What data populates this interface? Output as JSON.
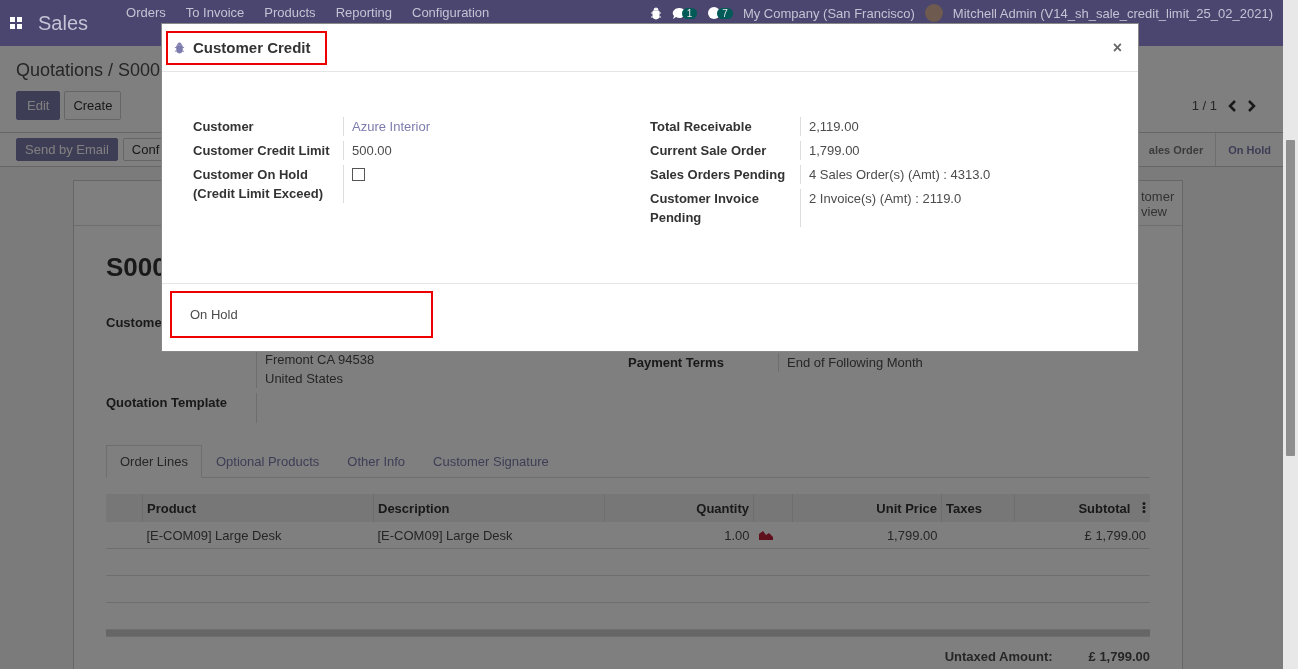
{
  "navbar": {
    "app_title": "Sales",
    "menu": [
      "Orders",
      "To Invoice",
      "Products",
      "Reporting",
      "Configuration"
    ],
    "messages_badge": "1",
    "activities_badge": "7",
    "company": "My Company (San Francisco)",
    "user": "Mitchell Admin (V14_sh_sale_credit_limit_25_02_2021)"
  },
  "control_panel": {
    "breadcrumb": "Quotations / S000",
    "buttons": [
      "Edit",
      "Create"
    ],
    "pager": "1 / 1"
  },
  "status_bar": {
    "buttons": [
      "Send by Email",
      "Conf"
    ],
    "stages": [
      {
        "label": "ales Order",
        "selected": false
      },
      {
        "label": "On Hold",
        "selected": true
      }
    ]
  },
  "sheet": {
    "smart_button": "tomer\nview",
    "title": "S000",
    "left_fields": [
      {
        "label": "Custome",
        "lines": [
          "Fremont CA 94538",
          "United States"
        ]
      },
      {
        "label": "Quotation Template"
      }
    ],
    "right_fields": [
      {
        "label": "Payment Terms",
        "value": "End of Following Month"
      }
    ],
    "tabs": [
      {
        "label": "Order Lines",
        "selected": true
      },
      {
        "label": "Optional Products",
        "selected": false
      },
      {
        "label": "Other Info",
        "selected": false
      },
      {
        "label": "Customer Signature",
        "selected": false
      }
    ],
    "table": {
      "columns": [
        "Product",
        "Description",
        "Quantity",
        "Unit Price",
        "Taxes",
        "Subtotal"
      ],
      "rows": [
        {
          "product": "[E-COM09] Large Desk",
          "description": "[E-COM09] Large Desk",
          "quantity": "1.00",
          "unit_price": "1,799.00",
          "taxes": "",
          "subtotal": "£ 1,799.00"
        }
      ]
    },
    "totals": [
      {
        "label": "Untaxed Amount:",
        "value": "£ 1,799.00"
      }
    ]
  },
  "dialog": {
    "title": "Customer Credit",
    "left_fields": [
      {
        "kind": "link",
        "label": "Customer",
        "value": "Azure Interior"
      },
      {
        "kind": "text",
        "label": "Customer Credit Limit",
        "value": "500.00"
      },
      {
        "kind": "checkbox",
        "label": "Customer On Hold (Credit Limit Exceed)",
        "checked": false
      }
    ],
    "right_fields": [
      {
        "kind": "text",
        "label": "Total Receivable",
        "value": "2,119.00"
      },
      {
        "kind": "text",
        "label": "Current Sale Order",
        "value": "1,799.00"
      },
      {
        "kind": "text",
        "label": "Sales Orders Pending",
        "value": "4 Sales Order(s) (Amt) : 4313.0"
      },
      {
        "kind": "text",
        "label": "Customer Invoice Pending",
        "value": "2 Invoice(s) (Amt) : 2119.0"
      }
    ],
    "close_label": "×",
    "footer_button": "On Hold"
  }
}
